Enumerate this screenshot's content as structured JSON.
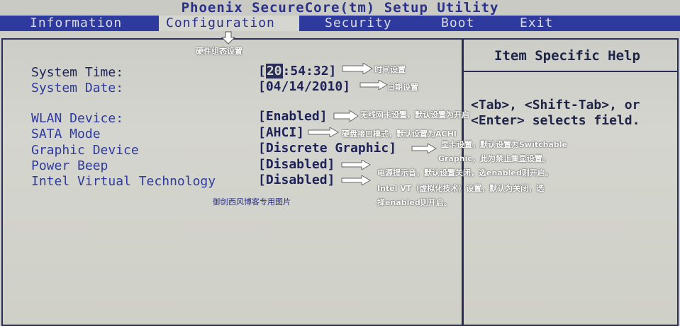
{
  "title": "Phoenix SecureCore(tm) Setup Utility",
  "tabs": [
    {
      "label": "Information",
      "active": false
    },
    {
      "label": "Configuration",
      "active": true
    },
    {
      "label": "Security",
      "active": false
    },
    {
      "label": "Boot",
      "active": false
    },
    {
      "label": "Exit",
      "active": false
    }
  ],
  "section_note": "硬件组态设置",
  "settings": [
    {
      "label": "System Time:",
      "value_hl": "20",
      "value_rest": ":54:32]",
      "value_open": "[",
      "note": "时间设置"
    },
    {
      "label": "System Date:",
      "value": "[04/14/2010]",
      "note": "日期设置"
    },
    {
      "label": "WLAN Device:",
      "value": "[Enabled]",
      "note": "无线网卡设置，默认设置为开启"
    },
    {
      "label": "SATA Mode",
      "value": "[AHCI]",
      "note": "硬盘接口模式，默认设置为ACHI"
    },
    {
      "label": "Graphic Device",
      "value": "[Discrete Graphic]",
      "note": "显卡设置，默认设置为Switchable",
      "note2": "Graphic，此为禁止集显设置。"
    },
    {
      "label": "Power Beep",
      "value": "[Disabled]",
      "note": "电源提示音，默认设置关闭，选enabled则开启。"
    },
    {
      "label": "Intel Virtual Technology",
      "value": "[Disabled]",
      "note": "Intel VT（虚拟化技术）设置，默认为关闭，选",
      "note2": "择enabled则开启。"
    }
  ],
  "help": {
    "title": "Item Specific Help",
    "line1": "<Tab>, <Shift-Tab>, or",
    "line2": "<Enter> selects field."
  },
  "watermark": "御剑西风博客专用图片",
  "colors": {
    "menu_bg": "#2f3a9e",
    "screen_bg": "#d0d1ca",
    "text_blue": "#2f3a9e",
    "text_dark": "#1e2258"
  }
}
